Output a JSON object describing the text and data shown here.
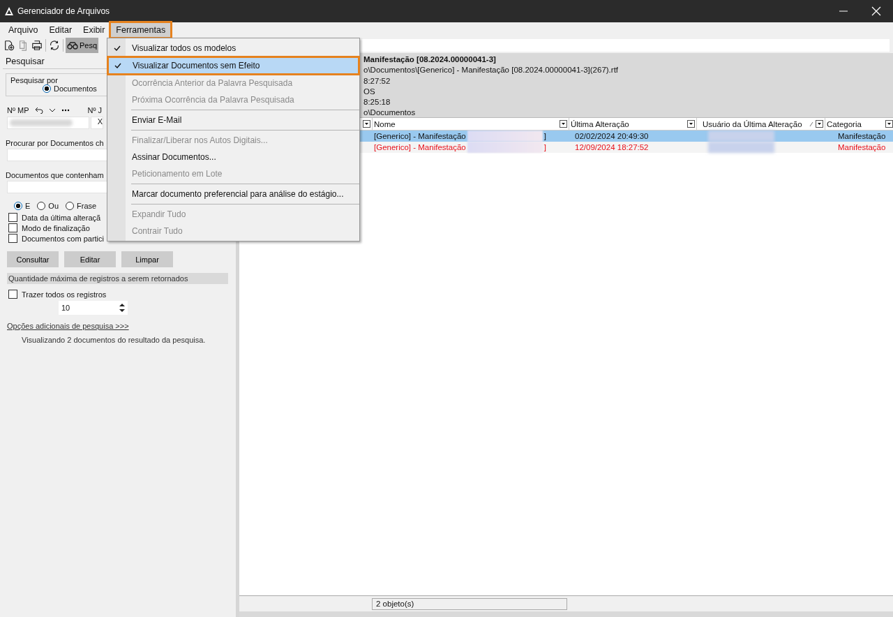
{
  "window": {
    "title": "Gerenciador de Arquivos"
  },
  "menu_bar": [
    {
      "label": "Arquivo",
      "selected": false
    },
    {
      "label": "Editar",
      "selected": false
    },
    {
      "label": "Exibir",
      "selected": false
    },
    {
      "label": "Ferramentas",
      "selected": true
    }
  ],
  "toolbar": {
    "search_button": "Pesq"
  },
  "search_panel": {
    "title": "Pesquisar",
    "search_by_label": "Pesquisar por",
    "search_by_option": {
      "label": "Documentos",
      "selected": true
    },
    "mp_label": "Nº MP",
    "j_label": "Nº J",
    "j_value": "X",
    "name_label": "Procurar por Documentos ch",
    "contains_label": "Documentos que contenham",
    "modes": [
      {
        "label": "E",
        "selected": true
      },
      {
        "label": "Ou",
        "selected": false
      },
      {
        "label": "Frase",
        "selected": false
      }
    ],
    "filters": [
      {
        "label": "Data da última alteraçã",
        "checked": false
      },
      {
        "label": "Modo de finalização",
        "checked": false
      },
      {
        "label": "Documentos com partici",
        "checked": false
      }
    ],
    "buttons": [
      "Consultar",
      "Editar",
      "Limpar"
    ],
    "limit_header": "Quantidade máxima de registros a serem retornados",
    "bring_all": {
      "label": "Trazer todos os registros",
      "checked": false
    },
    "limit_value": "10",
    "more_options": "Opções adicionais de pesquisa >>>",
    "result_text": "Visualizando 2 documentos do resultado da pesquisa."
  },
  "details": [
    "Manifestação [08.2024.00000041-3]",
    "o\\Documentos\\[Generico] - Manifestação [08.2024.00000041-3](267).rtf",
    "8:27:52",
    "OS",
    "8:25:18",
    "o\\Documentos"
  ],
  "table": {
    "columns": [
      "Nome",
      "Última Alteração",
      "Usuário da Última Alteração",
      "Categoria"
    ],
    "rows": [
      {
        "name": "[Generico] - Manifestação",
        "name_end": "]",
        "modified": "02/02/2024 20:49:30",
        "category": "Manifestação",
        "selected": true,
        "no_effect": false
      },
      {
        "name": "[Generico] - Manifestação",
        "name_end": "]",
        "modified": "12/09/2024 18:27:52",
        "category": "Manifestação",
        "selected": false,
        "no_effect": true
      }
    ]
  },
  "status_bar": {
    "count": "2 objeto(s)"
  },
  "dropdown_menu": [
    {
      "kind": "item",
      "label": "Visualizar todos os modelos",
      "checked": true,
      "disabled": false,
      "selected": false
    },
    {
      "kind": "item",
      "label": "Visualizar Documentos sem Efeito",
      "checked": true,
      "disabled": false,
      "selected": true
    },
    {
      "kind": "item",
      "label": "Ocorrência Anterior da Palavra Pesquisada",
      "checked": false,
      "disabled": true,
      "selected": false
    },
    {
      "kind": "item",
      "label": "Próxima Ocorrência da Palavra Pesquisada",
      "checked": false,
      "disabled": true,
      "selected": false
    },
    {
      "kind": "separator"
    },
    {
      "kind": "item",
      "label": "Enviar E-Mail",
      "checked": false,
      "disabled": false,
      "selected": false
    },
    {
      "kind": "separator"
    },
    {
      "kind": "item",
      "label": "Finalizar/Liberar nos Autos Digitais...",
      "checked": false,
      "disabled": true,
      "selected": false
    },
    {
      "kind": "item",
      "label": "Assinar Documentos...",
      "checked": false,
      "disabled": false,
      "selected": false
    },
    {
      "kind": "item",
      "label": "Peticionamento em Lote",
      "checked": false,
      "disabled": true,
      "selected": false
    },
    {
      "kind": "separator"
    },
    {
      "kind": "item",
      "label": "Marcar documento preferencial para análise do estágio...",
      "checked": false,
      "disabled": false,
      "selected": false
    },
    {
      "kind": "separator"
    },
    {
      "kind": "item",
      "label": "Expandir Tudo",
      "checked": false,
      "disabled": true,
      "selected": false
    },
    {
      "kind": "item",
      "label": "Contrair Tudo",
      "checked": false,
      "disabled": true,
      "selected": false
    }
  ]
}
